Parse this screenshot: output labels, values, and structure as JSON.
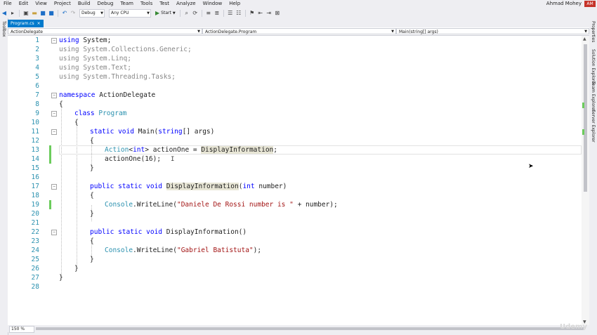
{
  "menu": [
    "File",
    "Edit",
    "View",
    "Project",
    "Build",
    "Debug",
    "Team",
    "Tools",
    "Test",
    "Analyze",
    "Window",
    "Help"
  ],
  "user": {
    "name": "Ahmad Mohey",
    "initials": "AM"
  },
  "toolbar": {
    "config": "Debug",
    "platform": "Any CPU",
    "start_label": "Start"
  },
  "left_rail": {
    "label": "Toolbox"
  },
  "right_rail": {
    "properties": "Properties",
    "solution": "Solution Explorer",
    "team": "Team Explorer",
    "server": "Server Explorer"
  },
  "tab": {
    "label": "Program.cs",
    "close": "×"
  },
  "nav": {
    "project": "ActionDelegate",
    "class": "ActionDelegate.Program",
    "member": "Main(string[] args)"
  },
  "zoom": "150 %",
  "watermark": "Udemy",
  "lines": [
    {
      "n": "1"
    },
    {
      "n": "2"
    },
    {
      "n": "3"
    },
    {
      "n": "4"
    },
    {
      "n": "5"
    },
    {
      "n": "6"
    },
    {
      "n": "7"
    },
    {
      "n": "8"
    },
    {
      "n": "9"
    },
    {
      "n": "10"
    },
    {
      "n": "11"
    },
    {
      "n": "12"
    },
    {
      "n": "13"
    },
    {
      "n": "14"
    },
    {
      "n": "15"
    },
    {
      "n": "16"
    },
    {
      "n": "17"
    },
    {
      "n": "18"
    },
    {
      "n": "19"
    },
    {
      "n": "20"
    },
    {
      "n": "21"
    },
    {
      "n": "22"
    },
    {
      "n": "23"
    },
    {
      "n": "24"
    },
    {
      "n": "25"
    },
    {
      "n": "26"
    },
    {
      "n": "27"
    },
    {
      "n": "28"
    }
  ],
  "code": {
    "l1_kw": "using",
    "l1_rest": " System;",
    "l2": "using System.Collections.Generic;",
    "l3": "using System.Linq;",
    "l4": "using System.Text;",
    "l5": "using System.Threading.Tasks;",
    "l7_kw": "namespace",
    "l7_rest": " ActionDelegate",
    "brace_open": "{",
    "brace_close": "}",
    "l9_kw": "class",
    "l9_type": "Program",
    "l11_kw1": "static",
    "l11_kw2": "void",
    "l11_name": " Main(",
    "l11_kw3": "string",
    "l11_rest": "[] args)",
    "l13_type": "Action",
    "l13_gen_open": "<",
    "l13_kw": "int",
    "l13_gen_close": ">",
    "l13_mid": " actionOne = ",
    "l13_ref": "DisplayInformation",
    "l13_end": ";",
    "l14": "actionOne(16);",
    "l17_kw1": "public",
    "l17_kw2": "static",
    "l17_kw3": "void",
    "l17_name": "DisplayInformation",
    "l17_kw4": "int",
    "l17_rest": " number)",
    "l19_type": "Console",
    "l19_mid": ".WriteLine(",
    "l19_str": "\"Daniele De Rossi number is \"",
    "l19_end": " + number);",
    "l22_kw1": "public",
    "l22_kw2": "static",
    "l22_kw3": "void",
    "l22_rest": " DisplayInformation()",
    "l24_type": "Console",
    "l24_mid": ".WriteLine(",
    "l24_str": "\"Gabriel Batistuta\"",
    "l24_end": ");"
  }
}
